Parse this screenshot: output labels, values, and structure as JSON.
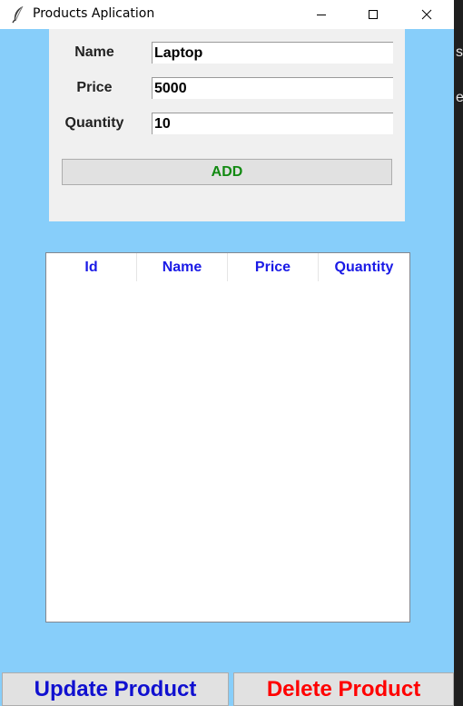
{
  "window": {
    "title": "Products Aplication",
    "icon": "feather-icon",
    "controls": [
      "minimize-icon",
      "maximize-icon",
      "close-icon"
    ]
  },
  "form": {
    "name_label": "Name",
    "name_value": "Laptop",
    "price_label": "Price",
    "price_value": "5000",
    "quantity_label": "Quantity",
    "quantity_value": "10",
    "add_label": "ADD"
  },
  "table": {
    "columns": [
      "Id",
      "Name",
      "Price",
      "Quantity"
    ],
    "rows": []
  },
  "actions": {
    "update_label": "Update Product",
    "delete_label": "Delete Product"
  },
  "background_glyphs": [
    "sc",
    "er"
  ],
  "colors": {
    "window_bg": "#87cefa",
    "header_text": "#1a1ae6",
    "add_text": "#128a12",
    "update_text": "#1010d0",
    "delete_text": "#ff0000"
  }
}
